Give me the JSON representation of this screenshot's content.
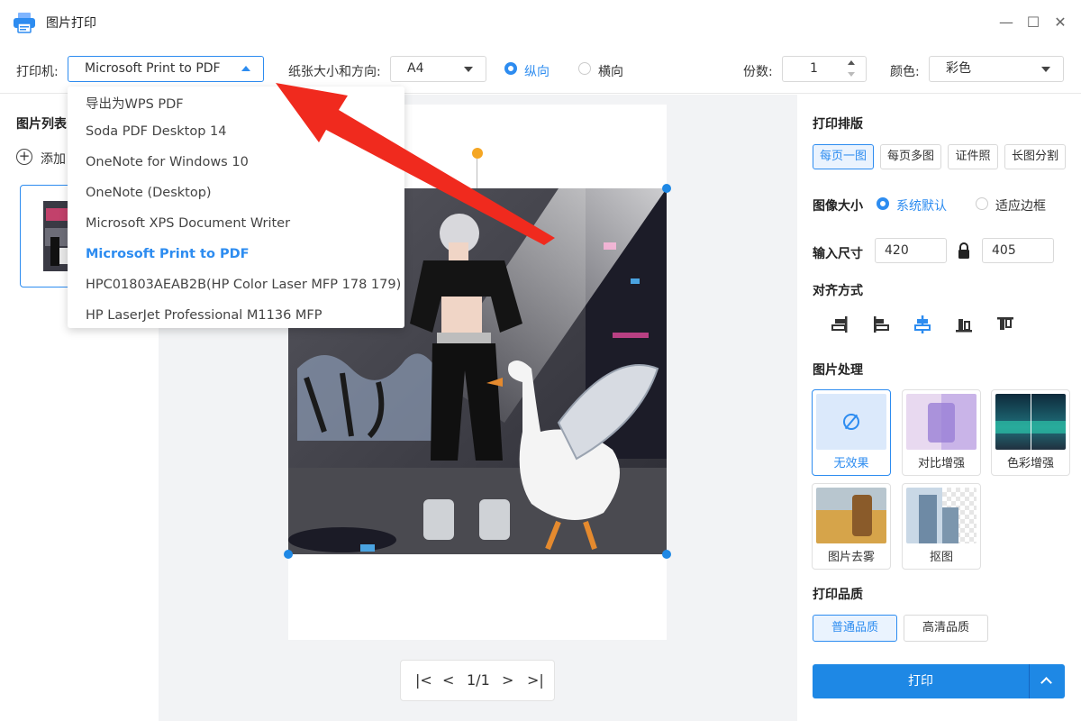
{
  "window": {
    "title": "图片打印",
    "minimize": "—",
    "maximize": "☐",
    "close": "✕"
  },
  "toolbar": {
    "printer_label": "打印机:",
    "printer_value": "Microsoft Print to PDF",
    "paper_label": "纸张大小和方向:",
    "paper_value": "A4",
    "portrait_label": "纵向",
    "landscape_label": "横向",
    "copies_label": "份数:",
    "copies_value": "1",
    "color_label": "颜色:",
    "color_value": "彩色"
  },
  "printer_options": [
    "导出为WPS PDF",
    "Soda PDF Desktop 14",
    "OneNote for Windows 10",
    "OneNote (Desktop)",
    "Microsoft XPS Document Writer",
    "Microsoft Print to PDF",
    "HPC01803AEAB2B(HP Color Laser MFP 178 179)",
    "HP LaserJet Professional M1136 MFP"
  ],
  "selected_printer_index": 5,
  "left_panel": {
    "title": "图片列表",
    "add_label": "添加"
  },
  "pager": {
    "first": "|<",
    "prev": "<",
    "page": "1/1",
    "next": ">",
    "last": ">|"
  },
  "right_panel": {
    "layout_title": "打印排版",
    "layout_options": [
      "每页一图",
      "每页多图",
      "证件照",
      "长图分割"
    ],
    "layout_selected": 0,
    "size_title": "图像大小",
    "size_default": "系统默认",
    "size_fit": "适应边框",
    "input_size_label": "输入尺寸",
    "width_value": "420",
    "height_value": "405",
    "align_title": "对齐方式",
    "process_title": "图片处理",
    "effects": [
      "无效果",
      "对比增强",
      "色彩增强",
      "图片去雾",
      "抠图"
    ],
    "effect_selected": 0,
    "quality_title": "打印品质",
    "quality_options": [
      "普通品质",
      "高清品质"
    ],
    "quality_selected": 0,
    "print_button": "打印"
  },
  "colors": {
    "accent": "#2d8cf0",
    "print_button": "#1e88e5",
    "annotation_arrow": "#f02a1e",
    "orange_handle": "#f5a623"
  }
}
